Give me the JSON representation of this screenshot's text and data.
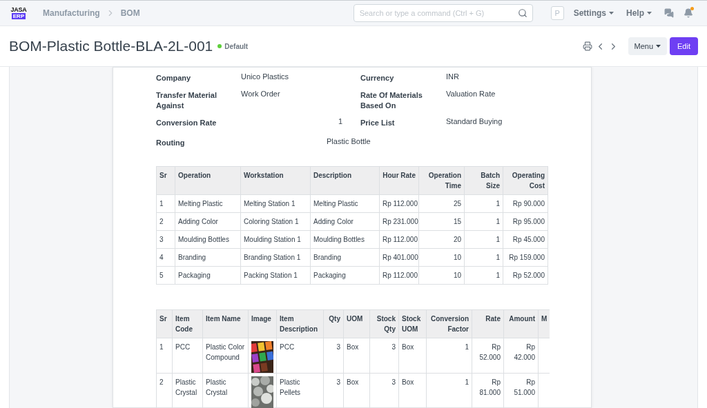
{
  "navbar": {
    "logo": {
      "top": "JASA",
      "bottom": "ERP"
    },
    "breadcrumbs": [
      "Manufacturing",
      "BOM"
    ],
    "search": {
      "placeholder": "Search or type a command (Ctrl + G)"
    },
    "avatar": "P",
    "menus": [
      "Settings",
      "Help"
    ],
    "notifications": {
      "unread": true
    }
  },
  "header": {
    "title": "BOM-Plastic Bottle-BLA-2L-001",
    "status": "Default",
    "menu_button": "Menu",
    "edit_button": "Edit"
  },
  "fields": [
    {
      "label": "Company",
      "value": "Unico Plastics",
      "kind": "text"
    },
    {
      "label": "Currency",
      "value": "INR",
      "kind": "text"
    },
    {
      "label": "Transfer Material Against",
      "value": "Work Order",
      "kind": "text"
    },
    {
      "label": "Rate Of Materials Based On",
      "value": "Valuation Rate",
      "kind": "text"
    },
    {
      "label": "Conversion Rate",
      "value": "1",
      "kind": "number"
    },
    {
      "label": "Price List",
      "value": "Standard Buying",
      "kind": "text"
    },
    {
      "label": "Routing",
      "value": "Plastic Bottle",
      "kind": "wide"
    }
  ],
  "operations": {
    "columns": [
      {
        "label": "Sr",
        "kind": "text"
      },
      {
        "label": "Operation",
        "kind": "text"
      },
      {
        "label": "Workstation",
        "kind": "text"
      },
      {
        "label": "Description",
        "kind": "text"
      },
      {
        "label": "Hour Rate",
        "kind": "number"
      },
      {
        "label": "Operation Time",
        "kind": "number"
      },
      {
        "label": "Batch Size",
        "kind": "number"
      },
      {
        "label": "Operating Cost",
        "kind": "number"
      }
    ],
    "rows": [
      [
        "1",
        "Melting Plastic",
        "Melting Station 1",
        "Melting Plastic",
        "Rp 112.000",
        "25",
        "1",
        "Rp 90.000"
      ],
      [
        "2",
        "Adding Color",
        "Coloring Station 1",
        "Adding Color",
        "Rp 231.000",
        "15",
        "1",
        "Rp 95.000"
      ],
      [
        "3",
        "Moulding Bottles",
        "Moulding Station 1",
        "Moulding Bottles",
        "Rp 112.000",
        "20",
        "1",
        "Rp 45.000"
      ],
      [
        "4",
        "Branding",
        "Branding Station 1",
        "Branding",
        "Rp 401.000",
        "10",
        "1",
        "Rp 159.000"
      ],
      [
        "5",
        "Packaging",
        "Packing Station 1",
        "Packaging",
        "Rp 112.000",
        "10",
        "1",
        "Rp 52.000"
      ]
    ]
  },
  "items": {
    "columns": [
      {
        "label": "Sr",
        "kind": "text"
      },
      {
        "label": "Item Code",
        "kind": "text"
      },
      {
        "label": "Item Name",
        "kind": "text"
      },
      {
        "label": "Image",
        "kind": "text"
      },
      {
        "label": "Item Description",
        "kind": "text"
      },
      {
        "label": "Qty",
        "kind": "number"
      },
      {
        "label": "UOM",
        "kind": "text"
      },
      {
        "label": "Stock Qty",
        "kind": "number"
      },
      {
        "label": "Stock UOM",
        "kind": "text"
      },
      {
        "label": "Conversion Factor",
        "kind": "number"
      },
      {
        "label": "Rate",
        "kind": "number"
      },
      {
        "label": "Amount",
        "kind": "number"
      },
      {
        "label": "M",
        "kind": "text"
      }
    ],
    "rows": [
      [
        "1",
        "PCC",
        "Plastic Color Compound",
        {
          "kind": "picture"
        },
        "PCC",
        "3",
        "Box",
        "3",
        "Box",
        "1",
        "Rp 52.000",
        "Rp 42.000",
        ""
      ],
      [
        "2",
        "Plastic Crystal",
        "Plastic Crystal",
        {
          "kind": "picture"
        },
        "Plastic Pellets",
        "3",
        "Box",
        "3",
        "Box",
        "1",
        "Rp 81.000",
        "Rp 51.000",
        ""
      ]
    ]
  }
}
